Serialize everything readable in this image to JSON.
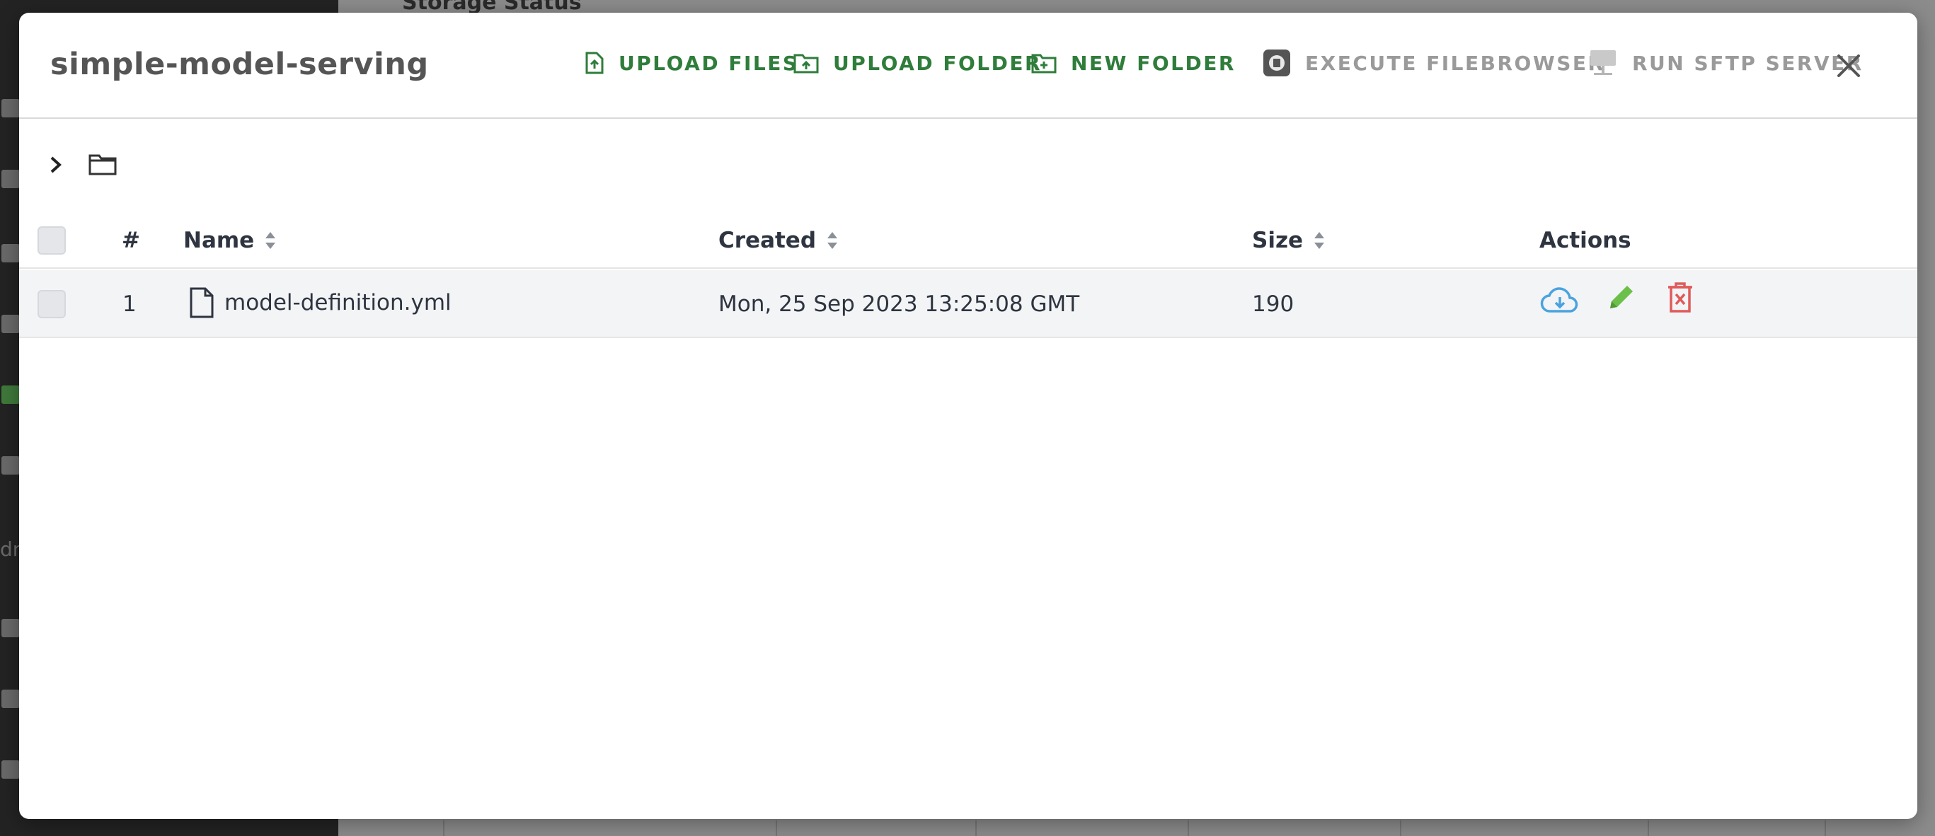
{
  "background": {
    "section_title": "Storage Status",
    "side_text": "dn"
  },
  "modal": {
    "title": "simple-model-serving",
    "buttons": {
      "upload_files": "UPLOAD FILES",
      "upload_folder": "UPLOAD FOLDER",
      "new_folder": "NEW FOLDER",
      "execute_filebrowser": "EXECUTE FILEBROWSER",
      "run_sftp_server": "RUN SFTP SERVER"
    },
    "colors": {
      "green_action": "#2f7d3b",
      "disabled": "#9a9a9a",
      "download": "#4aa3df",
      "edit": "#6cc04a",
      "delete": "#e05a5a"
    }
  },
  "table": {
    "headers": {
      "index": "#",
      "name": "Name",
      "created": "Created",
      "size": "Size",
      "actions": "Actions"
    },
    "rows": [
      {
        "index": "1",
        "name": "model-definition.yml",
        "created": "Mon, 25 Sep 2023 13:25:08 GMT",
        "size": "190",
        "icon": "file-icon"
      }
    ]
  }
}
